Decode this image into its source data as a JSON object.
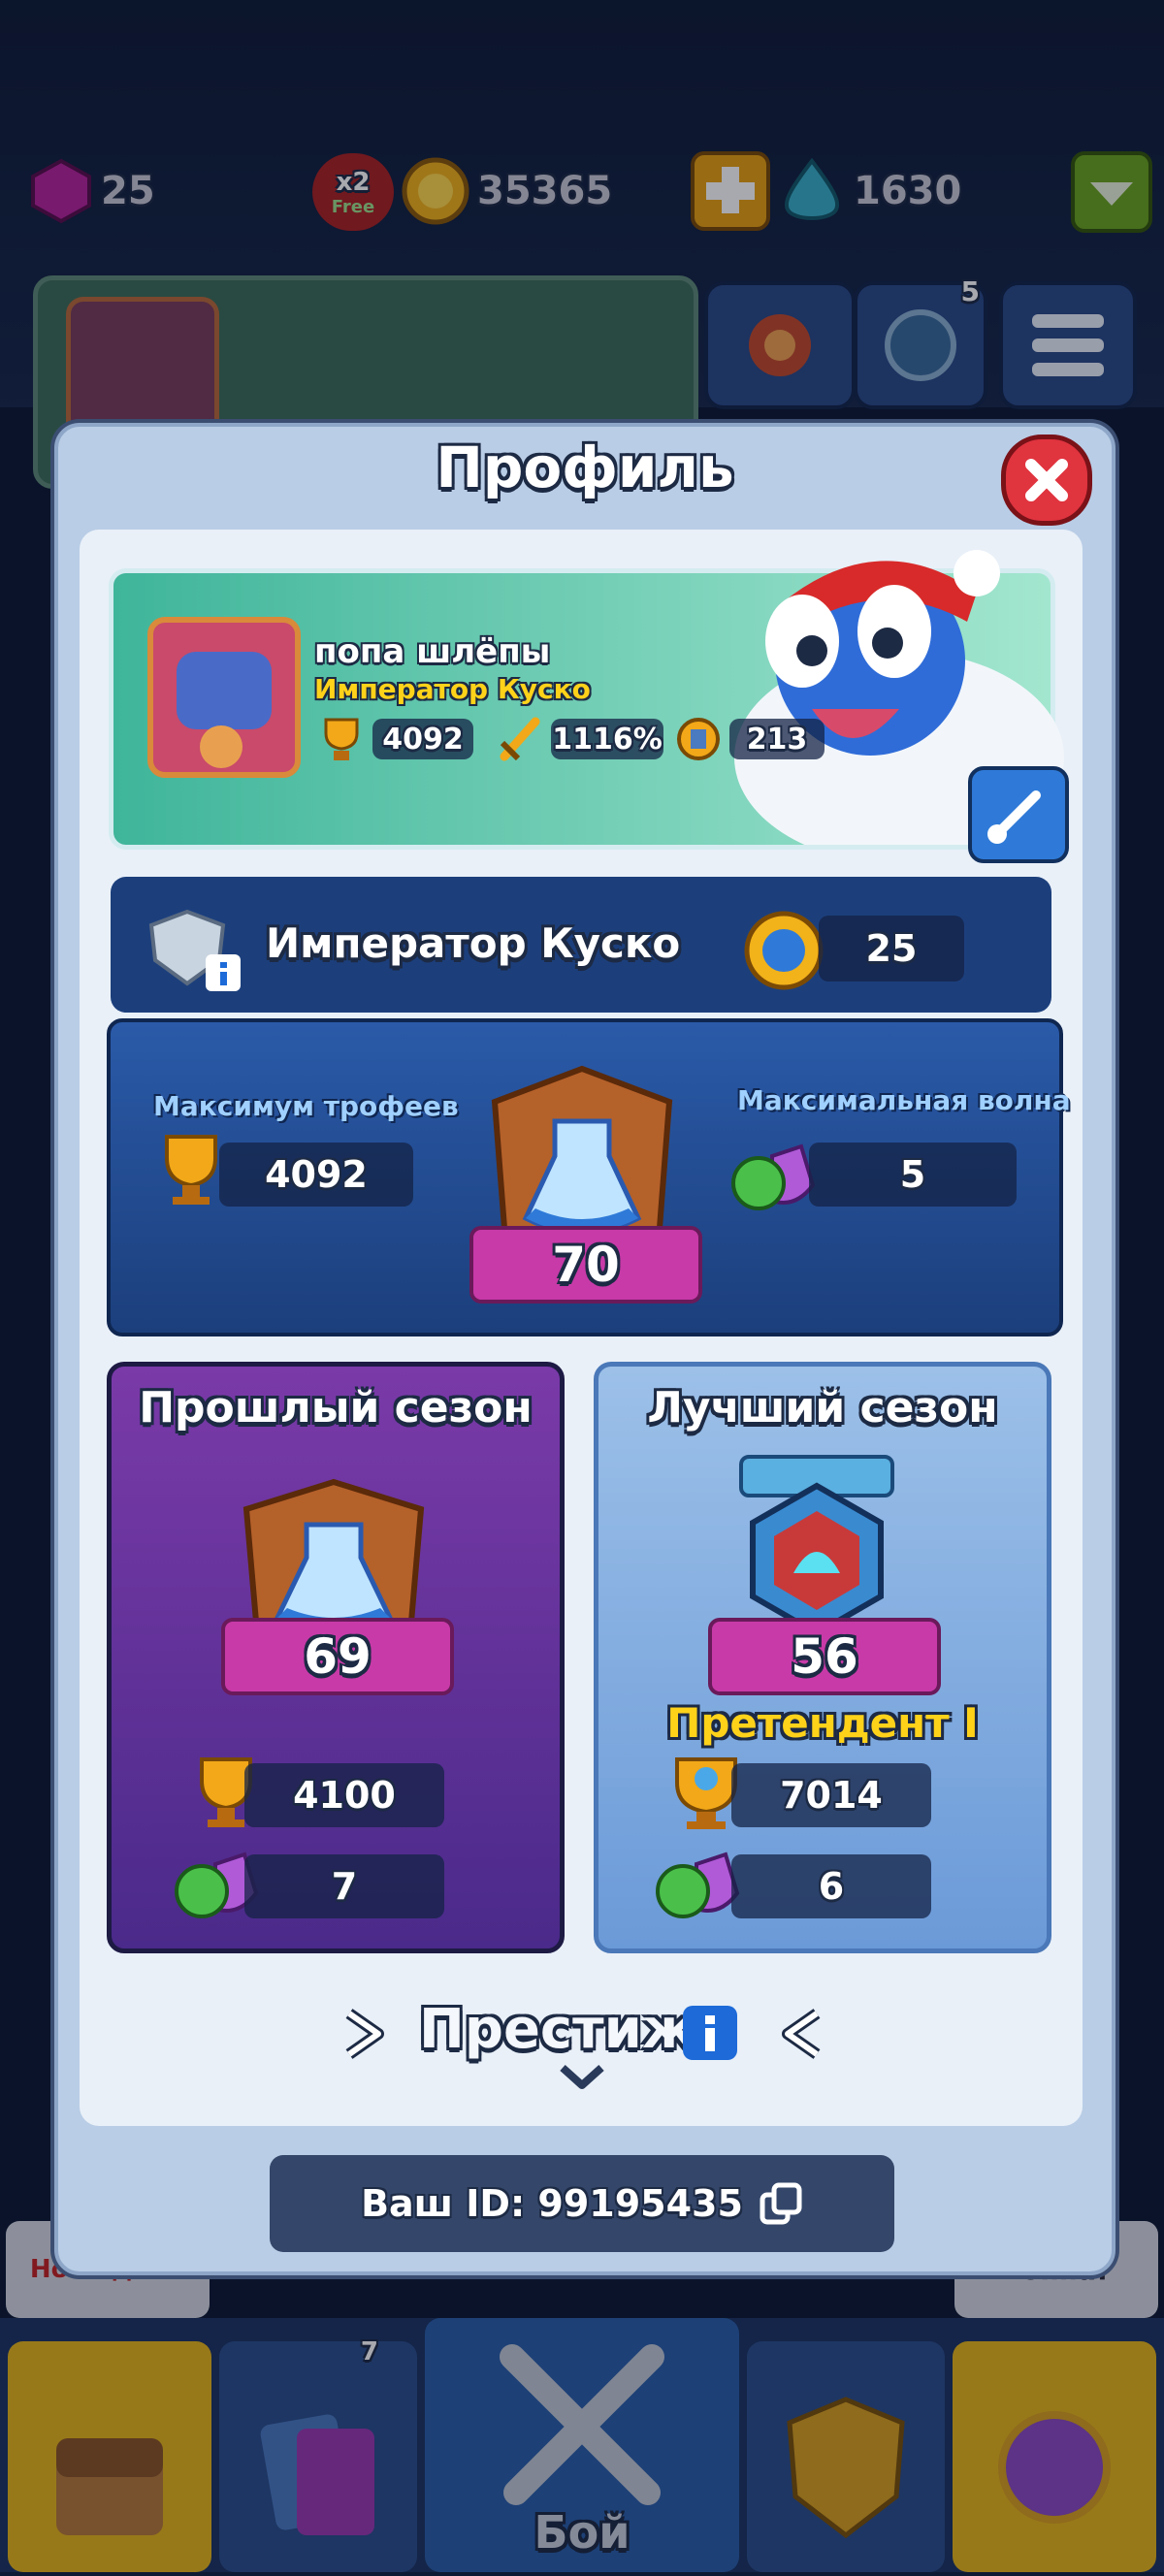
{
  "topbar": {
    "gems": "25",
    "x2_label": "x2",
    "free_label": "Free",
    "coins": "35365",
    "crystals": "1630",
    "menu_badge": "5"
  },
  "modal": {
    "title": "Профиль",
    "player": {
      "name": "попа шлёпы",
      "title": "Император Куско",
      "trophies": "4092",
      "crit": "1116%",
      "cards": "213"
    },
    "rank": {
      "name": "Император Куско",
      "level": "25"
    },
    "stats": {
      "max_trophies_label": "Максимум трофеев",
      "max_trophies": "4092",
      "max_wave_label": "Максимальная волна",
      "max_wave": "5",
      "current_league": "70"
    },
    "last_season": {
      "title": "Прошлый сезон",
      "league": "69",
      "trophies": "4100",
      "wave": "7"
    },
    "best_season": {
      "title": "Лучший сезон",
      "league": "56",
      "rank_title": "Претендент I",
      "trophies": "7014",
      "wave": "6"
    },
    "prestige_label": "Престиж",
    "player_id": "Ваш ID: 99195435"
  },
  "bottom_nav": {
    "left_bubble": "Но недели",
    "right_bubble": "война!",
    "cards_badge": "7",
    "battle_label": "Бой"
  },
  "colors": {
    "modal_bg": "#b9cde6",
    "panel_dark": "#1c3f7c",
    "purple": "#5a2f8a",
    "close_red": "#e0343f",
    "gold": "#ffd21a"
  }
}
